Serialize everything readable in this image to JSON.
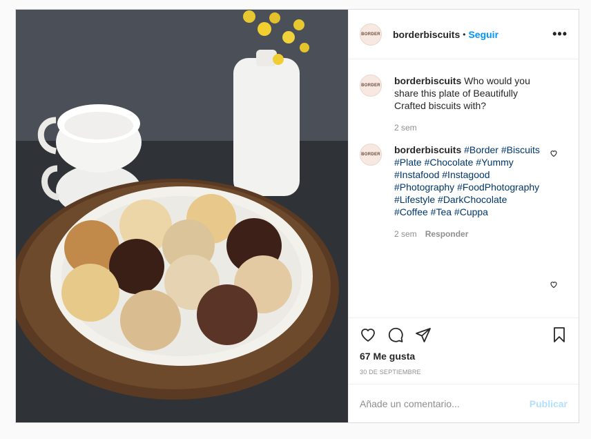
{
  "post": {
    "username": "borderbiscuits",
    "avatar_text": "BORDER",
    "dot": "•",
    "follow_label": "Seguir",
    "more_label": "•••",
    "caption": {
      "username": "borderbiscuits",
      "text": "Who would you share this plate of Beautifully Crafted biscuits with?",
      "time": "2 sem"
    },
    "comment": {
      "username": "borderbiscuits",
      "hashtags": "#Border #Biscuits #Plate #Chocolate #Yummy #Instafood #Instagood #Photography #FoodPhotography #Lifestyle #DarkChocolate #Coffee #Tea #Cuppa",
      "time": "2 sem",
      "reply_label": "Responder"
    },
    "likes": "67 Me gusta",
    "date": "30 DE SEPTIEMBRE",
    "add_comment_placeholder": "Añade un comentario...",
    "publish_label": "Publicar"
  }
}
